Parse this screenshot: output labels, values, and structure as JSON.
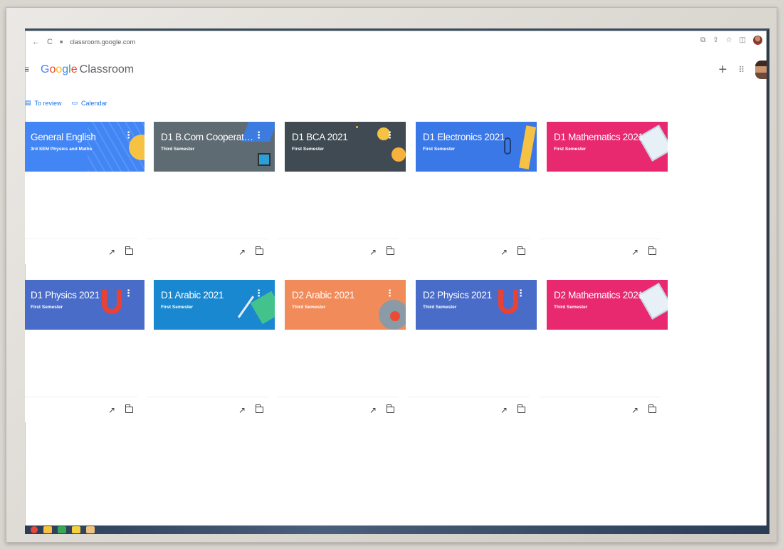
{
  "browser": {
    "url": "classroom.google.com",
    "nav_back": "←",
    "nav_reload": "C"
  },
  "app": {
    "brand_google": "Google",
    "brand_product": "Classroom"
  },
  "subnav": {
    "to_review": "To review",
    "calendar": "Calendar"
  },
  "cards": [
    {
      "title": "General English",
      "subtitle": "3rd SEM Physics and Maths",
      "color": "#4285f4"
    },
    {
      "title": "D1 B.Com Cooperatio...",
      "subtitle": "Third Semester",
      "color": "#5f6b73"
    },
    {
      "title": "D1 BCA 2021",
      "subtitle": "First Semester",
      "color": "#3f4a52"
    },
    {
      "title": "D1 Electronics 2021",
      "subtitle": "First Semester",
      "color": "#3b78e7"
    },
    {
      "title": "D1 Mathematics 2021",
      "subtitle": "First Semester",
      "color": "#e8286f"
    },
    {
      "title": "D1 Physics 2021",
      "subtitle": "First Semester",
      "color": "#4a6cc9"
    },
    {
      "title": "D1 Arabic 2021",
      "subtitle": "First Semester",
      "color": "#1a88d1"
    },
    {
      "title": "D2 Arabic 2021",
      "subtitle": "Third Semester",
      "color": "#f28b5a"
    },
    {
      "title": "D2 Physics 2021",
      "subtitle": "Third Semester",
      "color": "#4a6cc9"
    },
    {
      "title": "D2 Mathematics 2021",
      "subtitle": "Third Semester",
      "color": "#e8286f"
    }
  ]
}
